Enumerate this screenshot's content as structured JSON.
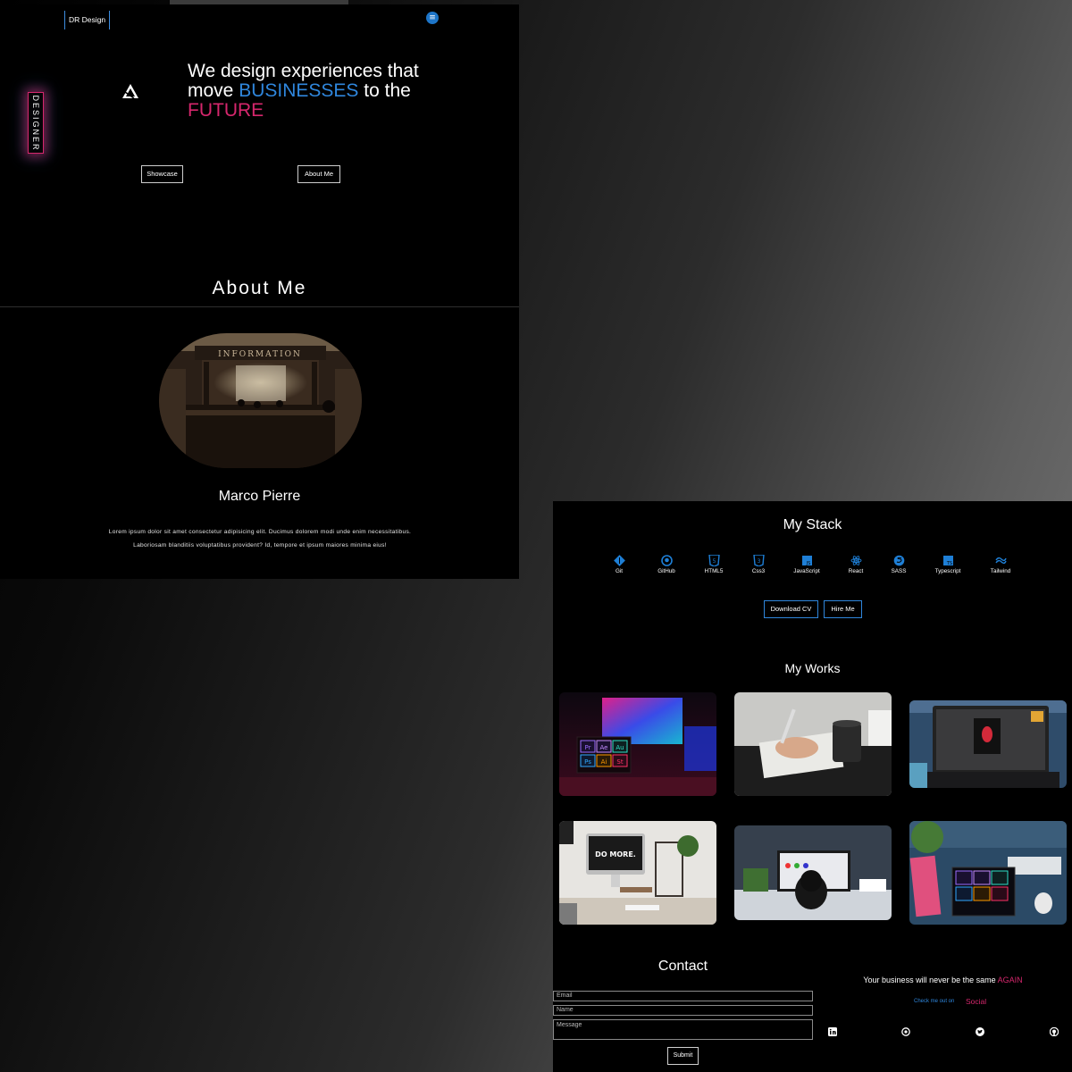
{
  "hero": {
    "brand": "DR Design",
    "menu_icon": "hamburger-icon",
    "badge": "DESIGNER",
    "logo_icon": "affinity-logo-icon",
    "headline_part1": "We design experiences that move",
    "headline_part2": "BUSINESSES",
    "headline_part3": "to the",
    "headline_part4": "FUTURE",
    "buttons": [
      "Showcase",
      "About Me"
    ]
  },
  "about": {
    "title": "About Me",
    "photo_sign": "INFORMATION",
    "name": "Marco Pierre",
    "bio": "Lorem ipsum dolor sit amet consectetur adipisicing elit. Ducimus dolorem modi unde enim necessitatibus. Laboriosam blanditiis voluptatibus provident? Id, tempore et ipsum maiores minima eius!"
  },
  "stack": {
    "title": "My Stack",
    "items": [
      {
        "label": "Git",
        "icon": "git-icon"
      },
      {
        "label": "GitHub",
        "icon": "github-icon"
      },
      {
        "label": "HTML5",
        "icon": "html5-icon"
      },
      {
        "label": "Css3",
        "icon": "css3-icon"
      },
      {
        "label": "JavaScript",
        "icon": "javascript-icon"
      },
      {
        "label": "React",
        "icon": "react-icon"
      },
      {
        "label": "SASS",
        "icon": "sass-icon"
      },
      {
        "label": "Typescript",
        "icon": "typescript-icon"
      },
      {
        "label": "Tailwind",
        "icon": "tailwind-icon"
      }
    ],
    "buttons": [
      "Download CV",
      "Hire Me"
    ]
  },
  "works": {
    "title": "My Works",
    "items": [
      {
        "name": "work-adobe-neon-desk"
      },
      {
        "name": "work-sketching-hand"
      },
      {
        "name": "work-laptop-photoshop"
      },
      {
        "name": "work-imac-do-more",
        "screen_text": "DO MORE."
      },
      {
        "name": "work-designer-at-desk"
      },
      {
        "name": "work-adobe-icons-tablet"
      }
    ],
    "adobe_labels": [
      "Pr",
      "Ae",
      "Au",
      "Ps",
      "Ai",
      "St"
    ]
  },
  "contact": {
    "title": "Contact",
    "email_placeholder": "Email",
    "name_placeholder": "Name",
    "message_placeholder": "Message",
    "submit": "Submit"
  },
  "footer": {
    "tagline_part1": "Your business will never be the same",
    "tagline_part2": "AGAIN",
    "check_text": "Check me out on",
    "social_text": "Social",
    "social_icons": [
      "linkedin-icon",
      "dribbble-icon",
      "twitter-icon",
      "github-icon"
    ]
  },
  "colors": {
    "accent_blue": "#2f86dc",
    "accent_pink": "#d6276d",
    "panel_bg": "#000000"
  }
}
